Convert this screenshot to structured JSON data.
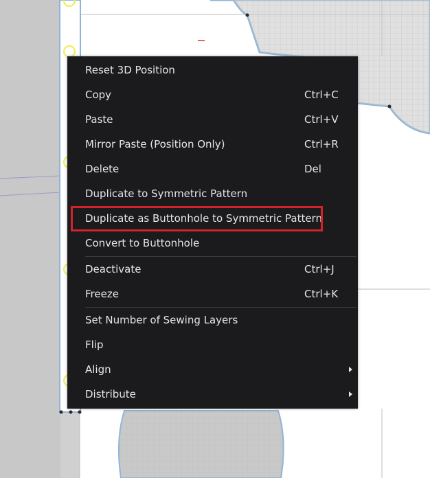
{
  "menu": {
    "items": [
      {
        "label": "Reset 3D Position",
        "shortcut": ""
      },
      {
        "label": "Copy",
        "shortcut": "Ctrl+C"
      },
      {
        "label": "Paste",
        "shortcut": "Ctrl+V"
      },
      {
        "label": "Mirror Paste (Position Only)",
        "shortcut": "Ctrl+R"
      },
      {
        "label": "Delete",
        "shortcut": "Del"
      },
      {
        "label": "Duplicate to Symmetric Pattern",
        "shortcut": ""
      },
      {
        "label": "Duplicate as Buttonhole to Symmetric Pattern",
        "shortcut": ""
      },
      {
        "label": "Convert to Buttonhole",
        "shortcut": ""
      },
      {
        "label": "Deactivate",
        "shortcut": "Ctrl+J"
      },
      {
        "label": "Freeze",
        "shortcut": "Ctrl+K"
      },
      {
        "label": "Set Number of Sewing Layers",
        "shortcut": ""
      },
      {
        "label": "Flip",
        "shortcut": ""
      },
      {
        "label": "Align",
        "shortcut": ""
      },
      {
        "label": "Distribute",
        "shortcut": ""
      }
    ],
    "highlighted_item": "Duplicate as Buttonhole to Symmetric Pattern"
  },
  "colors": {
    "menu_bg": "#1b1b1e",
    "menu_text": "#e6e6e6",
    "highlight_border": "#d3232a",
    "pattern_fill": "#c8c8c8",
    "pattern_outline": "#8fb4d8",
    "board_bg": "#ffffff",
    "grid": "#b4b4b4",
    "point_marker": "#f2ec46"
  }
}
